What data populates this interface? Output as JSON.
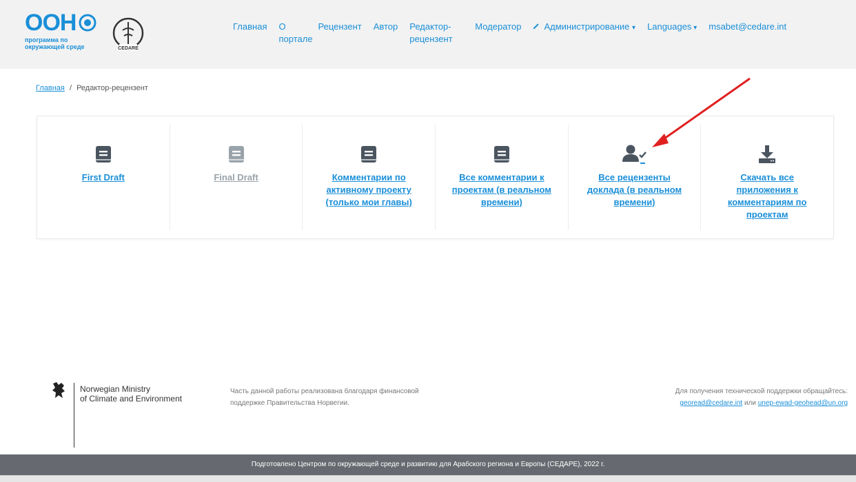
{
  "header": {
    "un_logo": {
      "title": "ООН",
      "subtitle_line1": "программа по",
      "subtitle_line2": "окружающей среде"
    },
    "cedare_logo": "CEDARE",
    "nav": [
      {
        "label": "Главная"
      },
      {
        "label": "О порталe"
      },
      {
        "label": "Рецензент"
      },
      {
        "label": "Автор"
      },
      {
        "label": "Редактор-рецензент"
      },
      {
        "label": "Модератор"
      },
      {
        "label": "Администрирование",
        "icon": "wrench-icon",
        "dropdown": true
      },
      {
        "label": "Languages",
        "dropdown": true
      },
      {
        "label": "msabet@cedare.int"
      }
    ]
  },
  "breadcrumb": {
    "home": "Главная",
    "separator": "/",
    "current": "Редактор-рецензент"
  },
  "tiles": [
    {
      "label": "First Draft",
      "icon": "book-icon",
      "muted": false
    },
    {
      "label": "Final Draft",
      "icon": "book-icon",
      "muted": true
    },
    {
      "label": "Комментарии по активному проекту (только мои главы)",
      "icon": "book-icon",
      "muted": false
    },
    {
      "label": "Все комментарии к проектам (в реальном времени)",
      "icon": "book-icon",
      "muted": false
    },
    {
      "label": "Все рецензенты доклада (в реальном времени)",
      "icon": "user-check-icon",
      "muted": false
    },
    {
      "label": "Скачать все приложения к комментариям по проектам",
      "icon": "download-icon",
      "muted": false
    }
  ],
  "footer": {
    "ministry_line1": "Norwegian Ministry",
    "ministry_line2": "of Climate and Environment",
    "funding_text": "Часть данной работы реализована благодаря финансовой поддержке Правительства Норвегии.",
    "support_text": "Для получения технической поддержки обращайтесь:",
    "support_email_1": "georead@cedare.int",
    "support_or": "или",
    "support_email_2": "unep-ewad-geohead@un.org",
    "bottom_bar": "Подготовлено Центром по окружающей среде и развитию для Арабского региона и Европы (СЕДАРЕ), 2022 г."
  },
  "colors": {
    "link": "#1a8fd8",
    "icon": "#4a5560",
    "muted": "#9aa3aa",
    "arrow": "#e02020",
    "bottom_bar": "#666a70"
  }
}
